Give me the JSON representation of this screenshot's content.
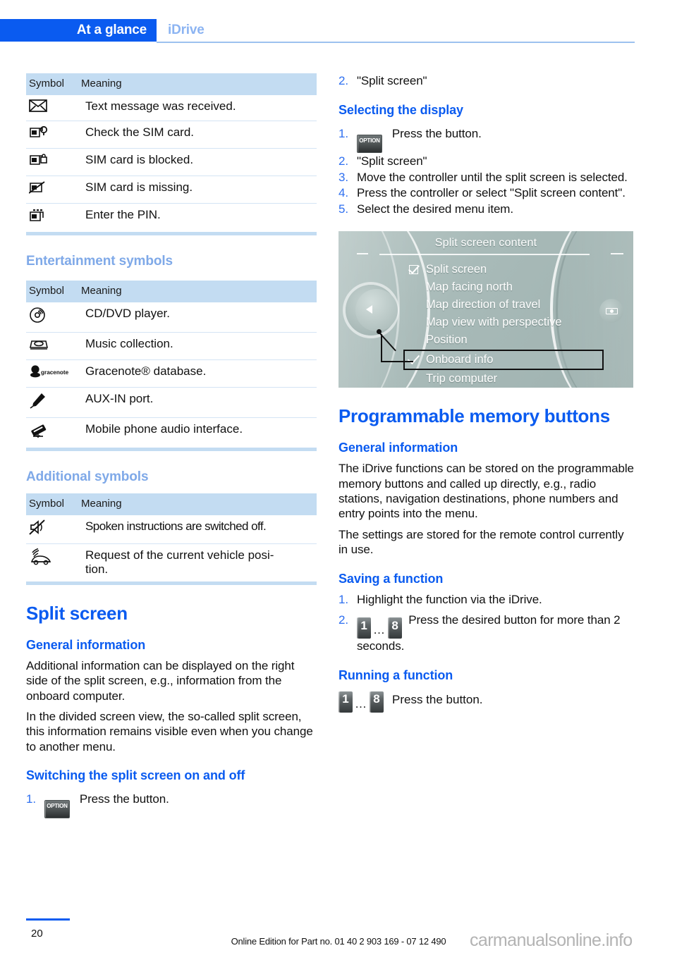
{
  "header": {
    "tab_active": "At a glance",
    "tab_inactive": "iDrive"
  },
  "tables": {
    "col_symbol": "Symbol",
    "col_meaning": "Meaning",
    "phone_symbols": {
      "rows": [
        {
          "icon": "envelope-icon",
          "meaning": "Text message was received."
        },
        {
          "icon": "sim-check-icon",
          "meaning": "Check the SIM card."
        },
        {
          "icon": "sim-locked-icon",
          "meaning": "SIM card is blocked."
        },
        {
          "icon": "sim-missing-icon",
          "meaning": "SIM card is missing."
        },
        {
          "icon": "sim-pin-icon",
          "meaning": "Enter the PIN."
        }
      ]
    },
    "entertainment": {
      "heading": "Entertainment symbols",
      "rows": [
        {
          "icon": "cd-dvd-icon",
          "meaning": "CD/DVD player."
        },
        {
          "icon": "music-collection-icon",
          "meaning": "Music collection."
        },
        {
          "icon": "gracenote-icon",
          "meaning": "Gracenote® database."
        },
        {
          "icon": "aux-in-icon",
          "meaning": "AUX-IN port."
        },
        {
          "icon": "mobile-audio-icon",
          "meaning": "Mobile phone audio interface."
        }
      ]
    },
    "additional": {
      "heading": "Additional symbols",
      "rows": [
        {
          "icon": "mute-icon",
          "meaning": "Spoken instructions are switched off."
        },
        {
          "icon": "vehicle-position-icon",
          "meaning": "Request of the current vehicle posi-\ntion."
        }
      ]
    }
  },
  "split_screen": {
    "title": "Split screen",
    "general_heading": "General information",
    "paragraphs": [
      "Additional information can be displayed on the right side of the split screen, e.g., information from the onboard computer.",
      "In the divided screen view, the so-called split screen, this information remains visible even when you change to another menu."
    ],
    "switching_heading": "Switching the split screen on and off",
    "switching_steps": [
      {
        "num": "1.",
        "text": "Press the button.",
        "icon": "option-button"
      },
      {
        "num": "2.",
        "text": "\"Split screen\""
      }
    ],
    "selecting_heading": "Selecting the display",
    "selecting_steps": [
      {
        "num": "1.",
        "text": "Press the button.",
        "icon": "option-button"
      },
      {
        "num": "2.",
        "text": "\"Split screen\""
      },
      {
        "num": "3.",
        "text": "Move the controller until the split screen is selected."
      },
      {
        "num": "4.",
        "text": "Press the controller or select \"Split screen content\"."
      },
      {
        "num": "5.",
        "text": "Select the desired menu item."
      }
    ]
  },
  "idrive_screen": {
    "title": "Split screen content",
    "menu_items": [
      {
        "label": "Split screen",
        "state": "checkbox"
      },
      {
        "label": "Map facing north",
        "state": "none"
      },
      {
        "label": "Map direction of travel",
        "state": "none"
      },
      {
        "label": "Map view with perspective",
        "state": "none"
      },
      {
        "label": "Position",
        "state": "none"
      },
      {
        "label": "Onboard info",
        "state": "checked-highlighted"
      },
      {
        "label": "Trip computer",
        "state": "none"
      }
    ]
  },
  "memory_buttons": {
    "title": "Programmable memory buttons",
    "general_heading": "General information",
    "paragraphs": [
      "The iDrive functions can be stored on the programmable memory buttons and called up directly, e.g., radio stations, navigation destinations, phone numbers and entry points into the menu.",
      "The settings are stored for the remote control currently in use."
    ],
    "saving_heading": "Saving a function",
    "saving_steps": [
      {
        "num": "1.",
        "text": "Highlight the function via the iDrive."
      },
      {
        "num": "2.",
        "text": "Press the desired button for more than 2 seconds.",
        "icon": "memory-buttons-1-8"
      }
    ],
    "running_heading": "Running a function",
    "running_text": "Press the button.",
    "button_first": "1",
    "button_last": "8",
    "button_ellipsis": "…"
  },
  "option_button_label": "OPTION",
  "footer": {
    "page_number": "20",
    "edition": "Online Edition for Part no. 01 40 2 903 169 - 07 12 490",
    "watermark": "carmanualsonline.info"
  },
  "colors": {
    "brand_blue": "#0a5bf0",
    "light_blue": "#7fa9e8",
    "table_header_bg": "#c3dcf2",
    "row_divider": "#d4e4f4"
  }
}
